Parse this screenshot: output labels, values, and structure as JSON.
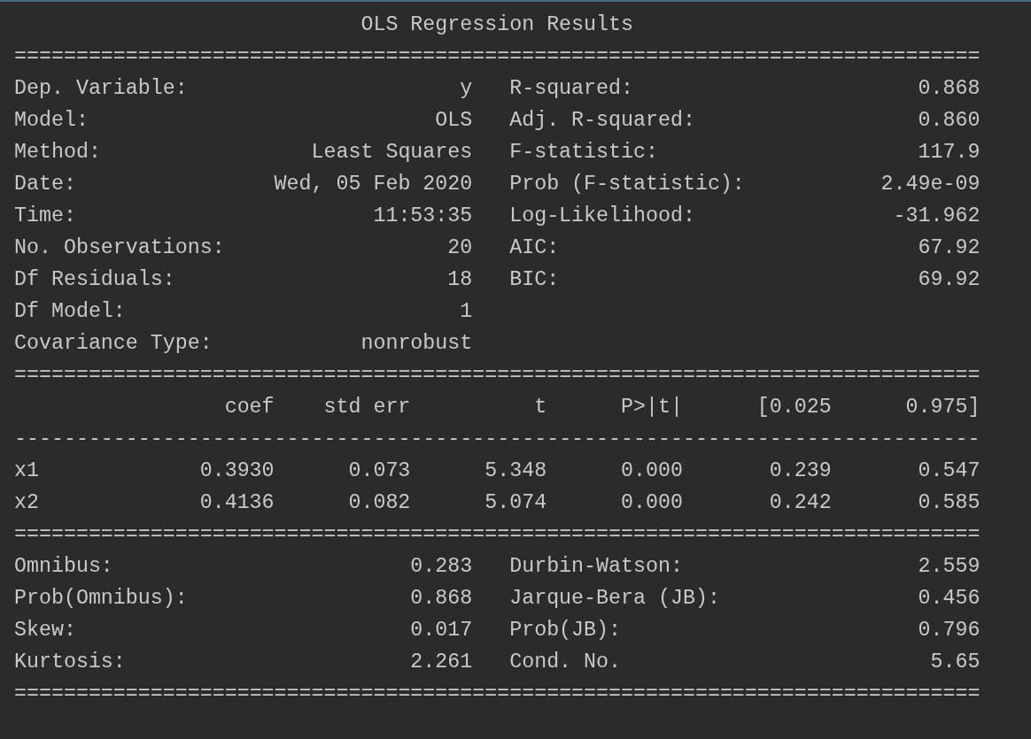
{
  "title": "OLS Regression Results",
  "rule_top": "==============================================================================",
  "summary": [
    {
      "left_label": "Dep. Variable:",
      "left_value": "y",
      "right_label": "R-squared:",
      "right_value": "0.868"
    },
    {
      "left_label": "Model:",
      "left_value": "OLS",
      "right_label": "Adj. R-squared:",
      "right_value": "0.860"
    },
    {
      "left_label": "Method:",
      "left_value": "Least Squares",
      "right_label": "F-statistic:",
      "right_value": "117.9"
    },
    {
      "left_label": "Date:",
      "left_value": "Wed, 05 Feb 2020",
      "right_label": "Prob (F-statistic):",
      "right_value": "2.49e-09"
    },
    {
      "left_label": "Time:",
      "left_value": "11:53:35",
      "right_label": "Log-Likelihood:",
      "right_value": "-31.962"
    },
    {
      "left_label": "No. Observations:",
      "left_value": "20",
      "right_label": "AIC:",
      "right_value": "67.92"
    },
    {
      "left_label": "Df Residuals:",
      "left_value": "18",
      "right_label": "BIC:",
      "right_value": "69.92"
    },
    {
      "left_label": "Df Model:",
      "left_value": "1"
    },
    {
      "left_label": "Covariance Type:",
      "left_value": "nonrobust"
    }
  ],
  "rule_mid": "==============================================================================",
  "coef_table": {
    "columns": [
      "coef",
      "std err",
      "t",
      "P>|t|",
      "[0.025",
      "0.975]"
    ],
    "rule": "------------------------------------------------------------------------------",
    "rows": [
      {
        "name": "x1",
        "cells": [
          "0.3930",
          "0.073",
          "5.348",
          "0.000",
          "0.239",
          "0.547"
        ]
      },
      {
        "name": "x2",
        "cells": [
          "0.4136",
          "0.082",
          "5.074",
          "0.000",
          "0.242",
          "0.585"
        ]
      }
    ]
  },
  "rule_table_end": "==============================================================================",
  "diagnostics": [
    {
      "left_label": "Omnibus:",
      "left_value": "0.283",
      "right_label": "Durbin-Watson:",
      "right_value": "2.559"
    },
    {
      "left_label": "Prob(Omnibus):",
      "left_value": "0.868",
      "right_label": "Jarque-Bera (JB):",
      "right_value": "0.456"
    },
    {
      "left_label": "Skew:",
      "left_value": "0.017",
      "right_label": "Prob(JB):",
      "right_value": "0.796"
    },
    {
      "left_label": "Kurtosis:",
      "left_value": "2.261",
      "right_label": "Cond. No.",
      "right_value": "5.65"
    }
  ],
  "rule_bottom": "=============================================================================="
}
